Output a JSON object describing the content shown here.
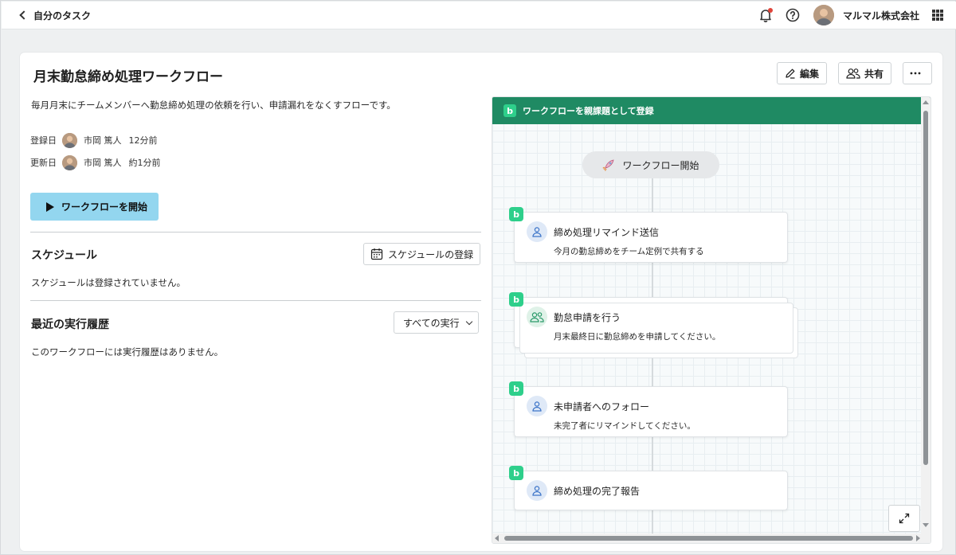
{
  "topbar": {
    "back_label": "自分のタスク",
    "company": "マルマル株式会社"
  },
  "workflow": {
    "title": "月末勤怠締め処理ワークフロー",
    "description": "毎月月末にチームメンバーへ勤怠締め処理の依頼を行い、申請漏れをなくすフローです。",
    "registered": {
      "label": "登録日",
      "user": "市岡 篤人",
      "time": "12分前"
    },
    "updated": {
      "label": "更新日",
      "user": "市岡 篤人",
      "time": "約1分前"
    },
    "start_label": "ワークフローを開始"
  },
  "actions": {
    "edit_label": "編集",
    "share_label": "共有"
  },
  "schedule": {
    "title": "スケジュール",
    "register_label": "スケジュールの登録",
    "empty_text": "スケジュールは登録されていません。"
  },
  "history": {
    "title": "最近の実行履歴",
    "filter_label": "すべての実行",
    "empty_text": "このワークフローには実行履歴はありません。"
  },
  "flow": {
    "header_label": "ワークフローを親課題として登録",
    "start_node": "ワークフロー開始",
    "logo_letter": "b",
    "nodes": [
      {
        "title": "締め処理リマインド送信",
        "subtitle": "今月の勤怠締めをチーム定例で共有する",
        "icon": "person-icon"
      },
      {
        "title": "勤怠申請を行う",
        "subtitle": "月末最終日に勤怠締めを申請してください。",
        "icon": "team-icon"
      },
      {
        "title": "未申請者へのフォロー",
        "subtitle": "未完了者にリマインドしてください。",
        "icon": "person-icon"
      },
      {
        "title": "締め処理の完了報告",
        "subtitle": "",
        "icon": "person-icon"
      }
    ]
  },
  "colors": {
    "flow_header": "#1f8a63",
    "badge": "#2ecf8b",
    "start_button": "#93d6ef",
    "notification_dot": "#e0443a"
  }
}
